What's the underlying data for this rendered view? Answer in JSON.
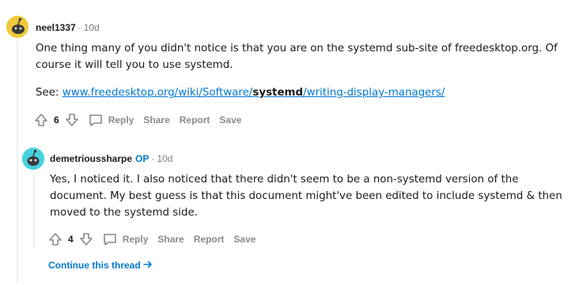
{
  "comments": [
    {
      "author": "neel1337",
      "is_op": false,
      "time": "10d",
      "paragraphs": [
        "One thing many of you didn't notice is that you are on the systemd sub-site of freedesktop.org. Of course it will tell you to use systemd."
      ],
      "see_prefix": "See: ",
      "link_text_part1": "www.freedesktop.org/wiki/Software/",
      "link_text_bold": "systemd",
      "link_text_part2": "/writing-display-managers/",
      "votes": "6",
      "reply_label": "Reply",
      "share_label": "Share",
      "report_label": "Report",
      "save_label": "Save",
      "avatar_color": "#e8c83a"
    },
    {
      "author": "demetrioussharpe",
      "is_op": true,
      "op_label": "OP",
      "time": "10d",
      "paragraphs": [
        "Yes, I noticed it. I also noticed that there didn't seem to be a non-systemd version of the document. My best guess is that this document might've been edited to include systemd & then moved to the systemd side."
      ],
      "votes": "4",
      "reply_label": "Reply",
      "share_label": "Share",
      "report_label": "Report",
      "save_label": "Save",
      "avatar_color": "#46d1e0"
    }
  ],
  "continue_thread": "Continue this thread",
  "separator": "·"
}
